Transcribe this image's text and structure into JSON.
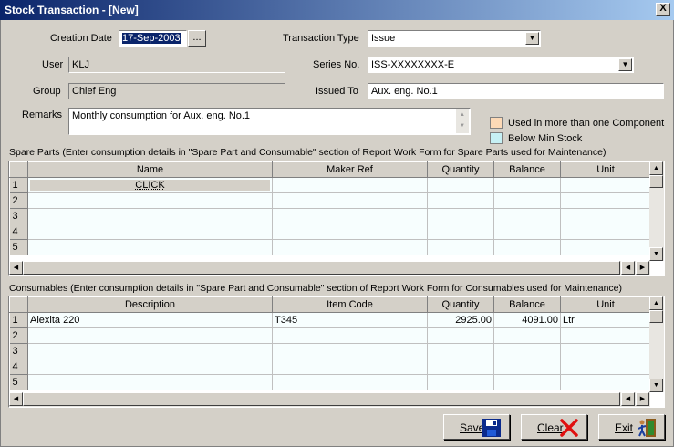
{
  "window": {
    "title": "Stock Transaction - [New]",
    "close_glyph": "X"
  },
  "form": {
    "creation_date_label": "Creation Date",
    "creation_date_value": "17-Sep-2003",
    "date_picker_label": "...",
    "transaction_type_label": "Transaction Type",
    "transaction_type_value": "Issue",
    "user_label": "User",
    "user_value": "KLJ",
    "series_label": "Series No.",
    "series_value": "ISS-XXXXXXXX-E",
    "group_label": "Group",
    "group_value": "Chief Eng",
    "issued_to_label": "Issued To",
    "issued_to_value": "Aux. eng. No.1",
    "remarks_label": "Remarks",
    "remarks_value": "Monthly consumption for Aux. eng. No.1"
  },
  "legend": {
    "multi_component": {
      "label": "Used in more than one Component",
      "color": "#fcd9b6"
    },
    "below_min": {
      "label": "Below Min Stock",
      "color": "#c6f0f4"
    }
  },
  "spare_parts": {
    "caption": "Spare Parts   (Enter consumption details in \"Spare Part and Consumable\" section of Report Work Form for Spare Parts used for Maintenance)",
    "columns": [
      "Name",
      "Maker Ref",
      "Quantity",
      "Balance",
      "Unit"
    ],
    "rows": [
      {
        "n": "1",
        "name": "CLICK",
        "maker": "",
        "qty": "",
        "bal": "",
        "unit": ""
      },
      {
        "n": "2",
        "name": "",
        "maker": "",
        "qty": "",
        "bal": "",
        "unit": ""
      },
      {
        "n": "3",
        "name": "",
        "maker": "",
        "qty": "",
        "bal": "",
        "unit": ""
      },
      {
        "n": "4",
        "name": "",
        "maker": "",
        "qty": "",
        "bal": "",
        "unit": ""
      },
      {
        "n": "5",
        "name": "",
        "maker": "",
        "qty": "",
        "bal": "",
        "unit": ""
      }
    ]
  },
  "consumables": {
    "caption": "Consumables  (Enter consumption details in \"Spare Part and Consumable\" section of Report Work Form for Consumables used for Maintenance)",
    "columns": [
      "Description",
      "Item Code",
      "Quantity",
      "Balance",
      "Unit"
    ],
    "rows": [
      {
        "n": "1",
        "desc": "Alexita 220",
        "code": "T345",
        "qty": "2925.00",
        "bal": "4091.00",
        "unit": "Ltr"
      },
      {
        "n": "2",
        "desc": "",
        "code": "",
        "qty": "",
        "bal": "",
        "unit": ""
      },
      {
        "n": "3",
        "desc": "",
        "code": "",
        "qty": "",
        "bal": "",
        "unit": ""
      },
      {
        "n": "4",
        "desc": "",
        "code": "",
        "qty": "",
        "bal": "",
        "unit": ""
      },
      {
        "n": "5",
        "desc": "",
        "code": "",
        "qty": "",
        "bal": "",
        "unit": ""
      }
    ]
  },
  "buttons": {
    "save": "Save",
    "clear": "Clear",
    "exit": "Exit"
  }
}
